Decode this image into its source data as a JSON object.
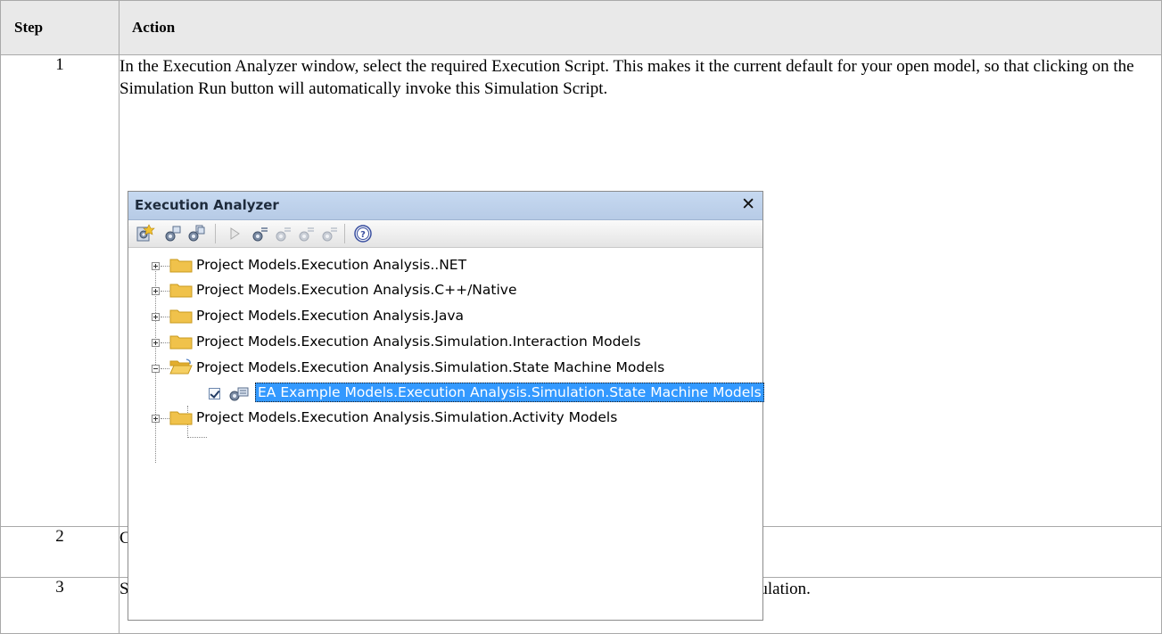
{
  "table": {
    "headers": {
      "step": "Step",
      "action": "Action"
    },
    "rows": [
      {
        "step": "1",
        "action": "In the Execution Analyzer window, select the required Execution Script. This makes it the current default for your open model, so that clicking on the Simulation Run button will automatically invoke this Simulation Script."
      },
      {
        "step": "2",
        "action": "Click on the checkbox to the left of the script to activate it."
      },
      {
        "step": "3",
        "action": "Select the 'Simulate > Simulator > Open Simulation Window' ribbon option to execute the simulation."
      }
    ]
  },
  "ea_window": {
    "title": "Execution Analyzer",
    "close_glyph": "✕",
    "toolbar_icons": [
      "new-script-icon",
      "edit-script-icon",
      "copy-script-icon",
      "run-icon",
      "build-icon",
      "test-icon",
      "debug-icon",
      "deploy-icon",
      "help-icon"
    ],
    "tree": [
      {
        "label": "Project Models.Execution Analysis..NET",
        "expanded": false
      },
      {
        "label": "Project Models.Execution Analysis.C++/Native",
        "expanded": false
      },
      {
        "label": "Project Models.Execution Analysis.Java",
        "expanded": false
      },
      {
        "label": "Project Models.Execution Analysis.Simulation.Interaction Models",
        "expanded": false
      },
      {
        "label": "Project Models.Execution Analysis.Simulation.State Machine Models",
        "expanded": true,
        "children": [
          {
            "label": "EA Example Models.Execution Analysis.Simulation.State Machine Models",
            "checked": true,
            "selected": true
          }
        ]
      },
      {
        "label": "Project Models.Execution Analysis.Simulation.Activity Models",
        "expanded": false
      }
    ]
  },
  "colors": {
    "header_bg": "#e9e9e9",
    "title_bar": "#c6d9f1",
    "selection": "#3399ff",
    "folder": "#f0c24b"
  }
}
